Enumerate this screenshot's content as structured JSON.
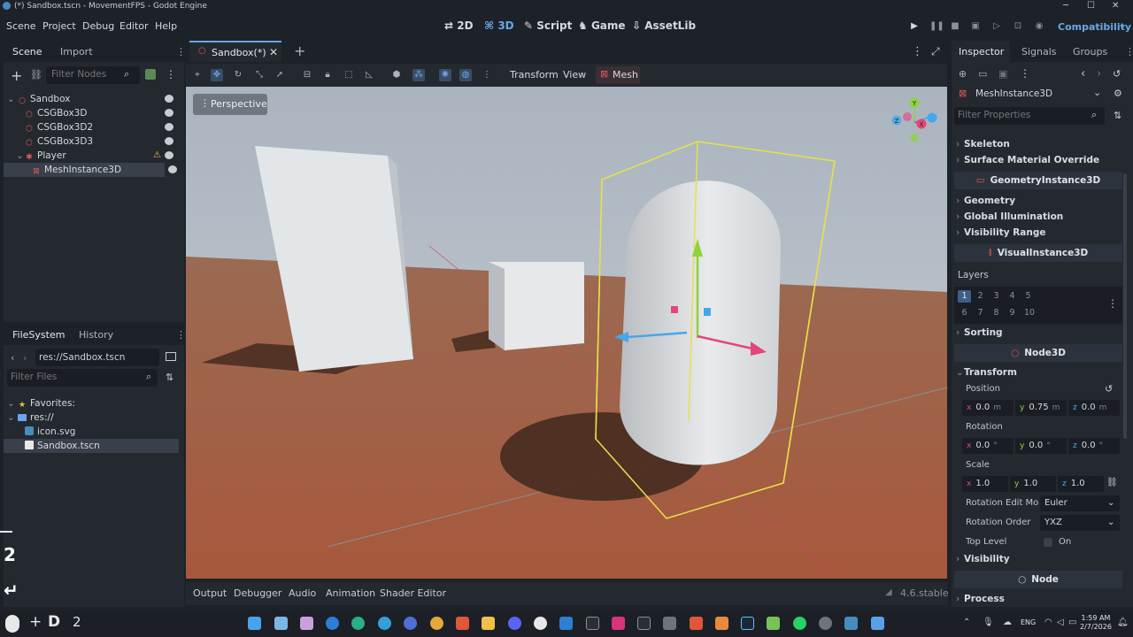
{
  "window": {
    "title": "(*) Sandbox.tscn - MovementFPS - Godot Engine"
  },
  "menu": [
    "Scene",
    "Project",
    "Debug",
    "Editor",
    "Help"
  ],
  "modes": {
    "m2d": "2D",
    "m3d": "3D",
    "script": "Script",
    "game": "Game",
    "assetlib": "AssetLib"
  },
  "renderer": "Compatibility",
  "scene_dock": {
    "tabs": [
      "Scene",
      "Import"
    ],
    "filter_placeholder": "Filter Nodes",
    "tree": [
      {
        "label": "Sandbox"
      },
      {
        "label": "CSGBox3D"
      },
      {
        "label": "CSGBox3D2"
      },
      {
        "label": "CSGBox3D3"
      },
      {
        "label": "Player"
      },
      {
        "label": "MeshInstance3D"
      }
    ]
  },
  "filesystem_dock": {
    "tabs": [
      "FileSystem",
      "History"
    ],
    "path": "res://Sandbox.tscn",
    "filter_placeholder": "Filter Files",
    "items": [
      {
        "label": "Favorites:"
      },
      {
        "label": "res://"
      },
      {
        "label": "icon.svg"
      },
      {
        "label": "Sandbox.tscn"
      }
    ]
  },
  "side_badges": {
    "top": "2",
    "bottom": "↵"
  },
  "editor_tabs": {
    "scene_tab": "Sandbox(*)",
    "add": "+"
  },
  "viewport_toolbar": {
    "transform": "Transform",
    "view": "View",
    "mesh": "Mesh"
  },
  "viewport": {
    "perspective_label": "Perspective",
    "gizmo": {
      "x": "X",
      "y": "Y",
      "z": "Z"
    }
  },
  "bottom_panel": {
    "tabs": [
      "Output",
      "Debugger",
      "Audio",
      "Animation",
      "Shader Editor"
    ],
    "version": "4.6.stable"
  },
  "inspector": {
    "tabs": [
      "Inspector",
      "Signals",
      "Groups"
    ],
    "node_type": "MeshInstance3D",
    "filter_placeholder": "Filter Properties",
    "skeleton": "Skeleton",
    "surface_override": "Surface Material Override",
    "geometry_instance": "GeometryInstance3D",
    "geometry": "Geometry",
    "global_illumination": "Global Illumination",
    "visibility_range": "Visibility Range",
    "visual_instance": "VisualInstance3D",
    "layers_label": "Layers",
    "layers": [
      "1",
      "2",
      "3",
      "4",
      "5",
      "6",
      "7",
      "8",
      "9",
      "10"
    ],
    "sorting": "Sorting",
    "node3d": "Node3D",
    "transform": "Transform",
    "position_label": "Position",
    "position": {
      "x": "0.0",
      "y": "0.75",
      "z": "0.0",
      "unit": "m"
    },
    "rotation_label": "Rotation",
    "rotation": {
      "x": "0.0",
      "y": "0.0",
      "z": "0.0",
      "unit": "°"
    },
    "scale_label": "Scale",
    "scale": {
      "x": "1.0",
      "y": "1.0",
      "z": "1.0"
    },
    "rotation_edit_mode_label": "Rotation Edit Mo",
    "rotation_edit_mode": "Euler",
    "rotation_order_label": "Rotation Order",
    "rotation_order": "YXZ",
    "top_level_label": "Top Level",
    "top_level_value": "On",
    "visibility": "Visibility",
    "node": "Node",
    "process": "Process"
  },
  "taskbar": {
    "lang": "ENG",
    "time": "1:59 AM",
    "date": "2/7/2026",
    "start_badge": "D",
    "start_num": "2"
  }
}
